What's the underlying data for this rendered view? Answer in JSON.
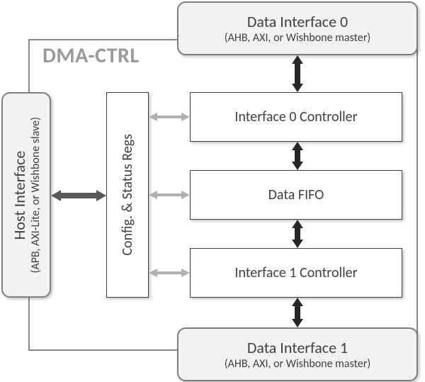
{
  "title": "DMA-CTRL",
  "data_interfaces": [
    {
      "name": "Data Interface 0",
      "sub": "(AHB, AXI, or Wishbone master)"
    },
    {
      "name": "Data Interface 1",
      "sub": "(AHB, AXI, or Wishbone master)"
    }
  ],
  "host_interface": {
    "name": "Host Interface",
    "sub": "(APB, AXI-Lite, or Wishbone slave)"
  },
  "blocks": {
    "config": "Config. & Status Regs",
    "if0": "Interface 0 Controller",
    "fifo": "Data FIFO",
    "if1": "Interface 1 Controller"
  }
}
